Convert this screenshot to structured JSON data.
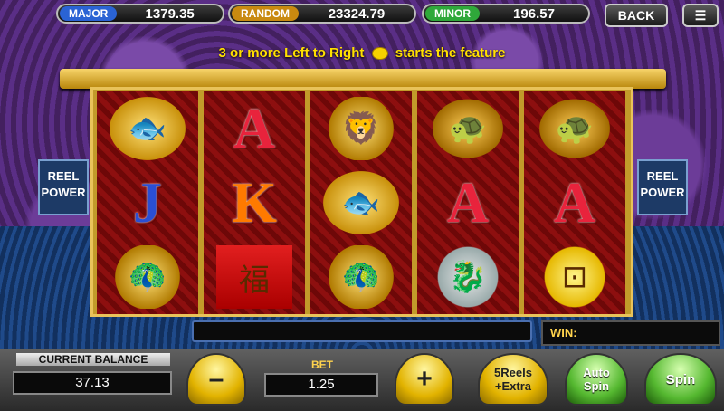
{
  "jackpots": [
    {
      "label": "MAJOR",
      "value": "1379.35",
      "color": "#2a63d4"
    },
    {
      "label": "RANDOM",
      "value": "23324.79",
      "color": "#c98a10"
    },
    {
      "label": "MINOR",
      "value": "196.57",
      "color": "#2fa83a"
    }
  ],
  "nav": {
    "back_label": "BACK",
    "menu_icon": "hamburger-icon"
  },
  "feature_text": {
    "before": "3 or more Left to Right",
    "after": "starts the feature"
  },
  "side_badge": {
    "line1": "REEL",
    "line2": "POWER"
  },
  "reels": [
    [
      "golden-carp",
      "J",
      "golden-phoenix"
    ],
    [
      "A",
      "K",
      "red-envelope"
    ],
    [
      "golden-foo-dog",
      "golden-carp",
      "golden-phoenix"
    ],
    [
      "golden-turtle",
      "A",
      "jade-dragon-plate"
    ],
    [
      "golden-turtle",
      "A",
      "gold-coin"
    ]
  ],
  "win_label": "WIN:",
  "balance": {
    "label": "CURRENT BALANCE",
    "value": "37.13"
  },
  "bet": {
    "label": "BET",
    "value": "1.25"
  },
  "buttons": {
    "minus": "–",
    "plus": "+",
    "extra": "5Reels\n+Extra",
    "autospin": "Auto\nSpin",
    "spin": "Spin"
  }
}
